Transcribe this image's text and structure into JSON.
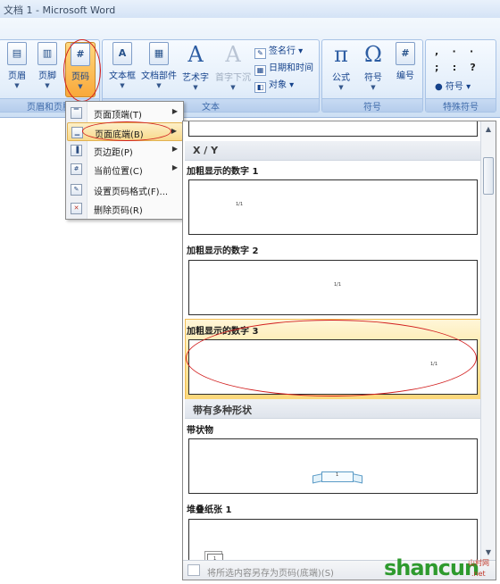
{
  "window": {
    "title": "文档 1 - Microsoft Word"
  },
  "ribbon": {
    "groups": {
      "header_footer": {
        "label": "页眉和页脚",
        "buttons": {
          "header": "页眉",
          "footer": "页脚",
          "page_number": "页码"
        }
      },
      "text": {
        "label": "文本",
        "buttons": {
          "textbox": "文本框",
          "quickparts": "文档部件",
          "wordart": "艺术字",
          "dropcap": "首字下沉",
          "signature": "签名行",
          "datetime": "日期和时间",
          "object": "对象"
        }
      },
      "symbols": {
        "label": "符号",
        "buttons": {
          "equation": "公式",
          "symbol": "符号",
          "number": "编号"
        }
      },
      "special": {
        "label": "特殊符号",
        "buttons": {
          "symbol": "符号"
        }
      }
    }
  },
  "page_number_menu": {
    "items": [
      {
        "label": "页面顶端(T)",
        "has_submenu": true
      },
      {
        "label": "页面底端(B)",
        "has_submenu": true,
        "highlighted": true
      },
      {
        "label": "页边距(P)",
        "has_submenu": true
      },
      {
        "label": "当前位置(C)",
        "has_submenu": true
      },
      {
        "label": "设置页码格式(F)...",
        "has_submenu": false
      },
      {
        "label": "删除页码(R)",
        "has_submenu": false
      }
    ]
  },
  "gallery": {
    "sections": {
      "xy": "X / Y",
      "shapes": "带有多种形状"
    },
    "items": [
      {
        "name": "加粗显示的数字 1",
        "page_marker": "1/1"
      },
      {
        "name": "加粗显示的数字 2",
        "page_marker": "1/1"
      },
      {
        "name": "加粗显示的数字 3",
        "page_marker": "1/1",
        "selected": true
      },
      {
        "name": "带状物",
        "page_marker": "1"
      },
      {
        "name": "堆叠纸张 1",
        "page_marker": "1"
      }
    ],
    "footer": "将所选内容另存为页码(底端)(S)"
  },
  "watermark": {
    "main": "shancun",
    "cn": "山村网",
    "net": ".net"
  },
  "colors": {
    "accent": "#15428b",
    "highlight_oval": "#d22020",
    "selection": "#fbd77a"
  }
}
